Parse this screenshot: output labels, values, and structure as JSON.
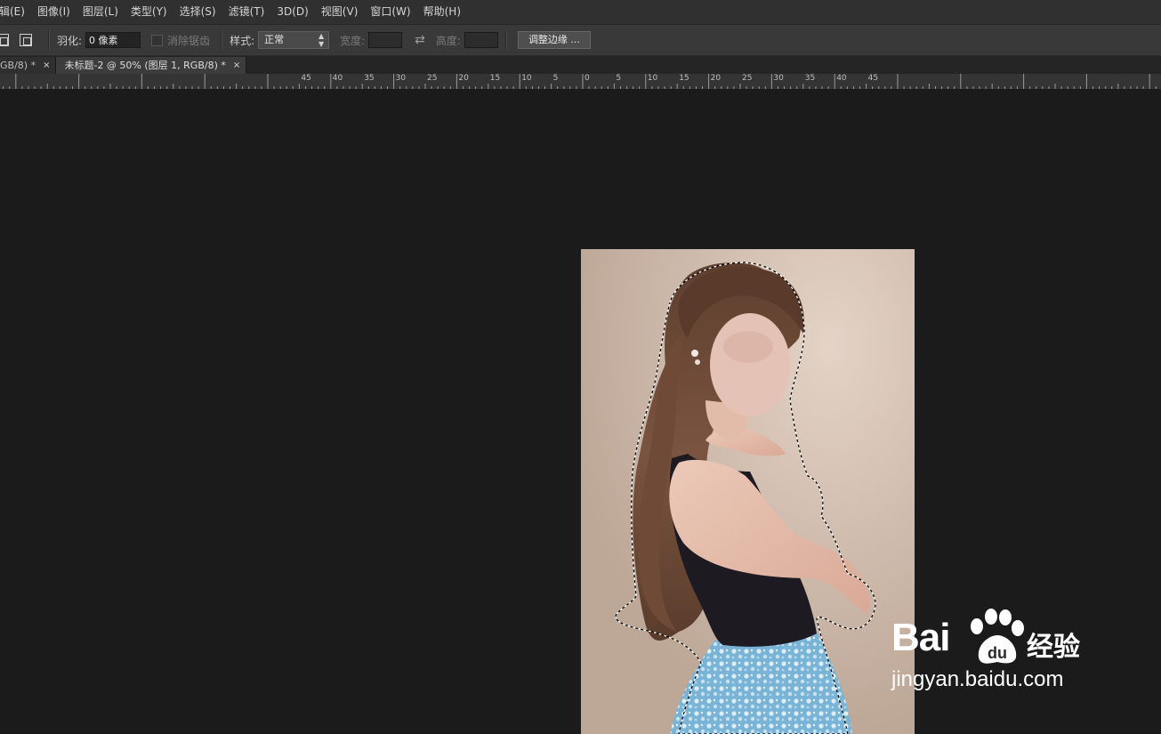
{
  "menu": [
    "辑(E)",
    "图像(I)",
    "图层(L)",
    "类型(Y)",
    "选择(S)",
    "滤镜(T)",
    "3D(D)",
    "视图(V)",
    "窗口(W)",
    "帮助(H)"
  ],
  "options": {
    "feather_label": "羽化:",
    "feather_value": "0 像素",
    "antialias_label": "消除锯齿",
    "style_label": "样式:",
    "style_value": "正常",
    "width_label": "宽度:",
    "height_label": "高度:",
    "refine_edge_button": "调整边缘 ..."
  },
  "tabs": [
    {
      "label": "GB/8) *",
      "close": "×"
    },
    {
      "label": "未标题-2 @ 50% (图层 1, RGB/8) *",
      "close": "×"
    }
  ],
  "ruler": {
    "labels": [
      "45",
      "40",
      "35",
      "30",
      "25",
      "20",
      "15",
      "10",
      "5",
      "0",
      "5",
      "10",
      "15",
      "20",
      "25",
      "30",
      "35",
      "40",
      "45"
    ]
  },
  "watermark": {
    "brand": "Bai",
    "brand_cn": "经验",
    "url": "jingyan.baidu.com"
  },
  "colors": {
    "menubar": "#303030",
    "optionsbar": "#393939",
    "canvas": "#1b1b1b",
    "skirt": "#7fb6d6",
    "top": "#1c1820",
    "hair": "#6b4a38"
  }
}
